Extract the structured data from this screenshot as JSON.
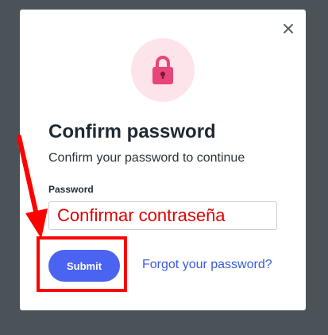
{
  "dialog": {
    "close_icon": "close-icon",
    "lock_icon": "lock-icon",
    "title": "Confirm password",
    "subtitle": "Confirm your password to continue",
    "password_label": "Password",
    "password_value": "Confirmar contraseña",
    "submit_label": "Submit",
    "forgot_link": "Forgot your password?"
  },
  "colors": {
    "overlay": "#4b5359",
    "accent": "#4a63f0",
    "link": "#3b5bdb",
    "lock": "#e8457a",
    "annotation": "#ff0000"
  }
}
